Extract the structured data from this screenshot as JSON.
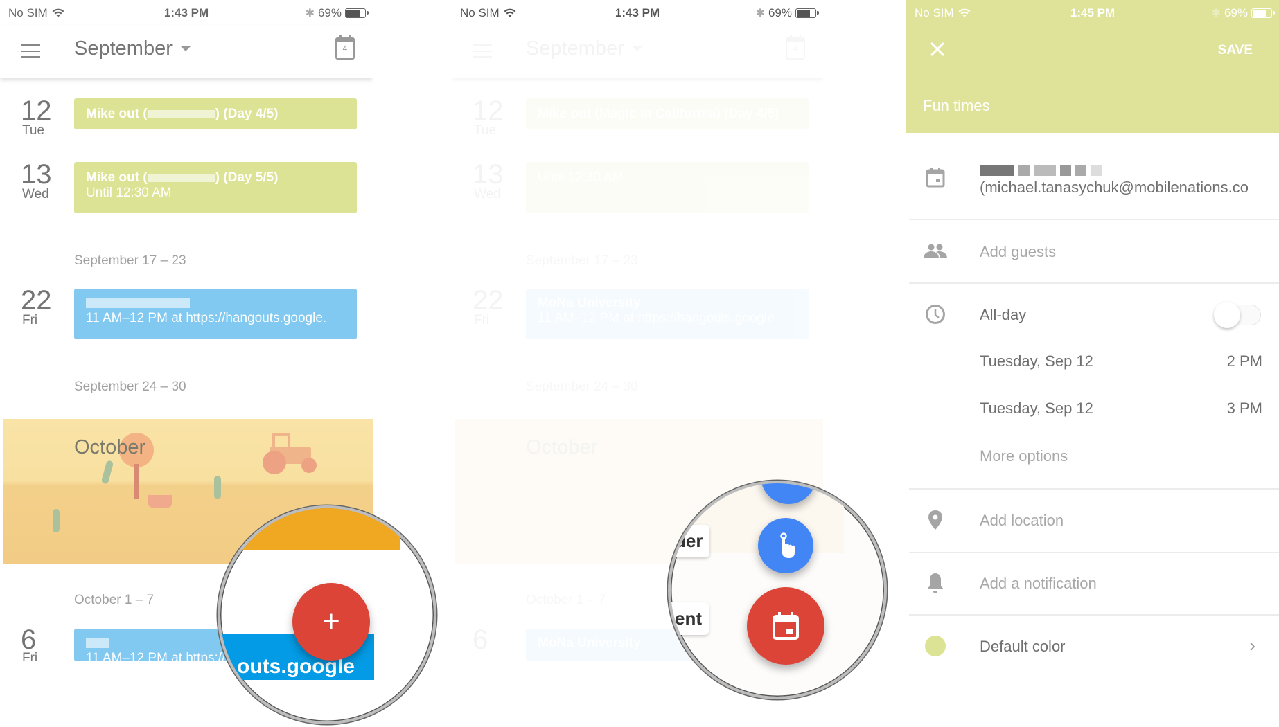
{
  "panels": {
    "agenda": {
      "status": {
        "carrier": "No SIM",
        "time": "1:43 PM",
        "battery": "69%",
        "battery_level": 0.69
      },
      "header": {
        "month": "September",
        "today_day": "4"
      },
      "days": [
        {
          "num": "12",
          "name": "Tue",
          "event_title": "Mike out (Magic in California) (Day 4/5)",
          "event_title_pre": "Mike out (",
          "event_title_post": ") (Day 4/5)",
          "event_sub": ""
        },
        {
          "num": "13",
          "name": "Wed",
          "event_title_pre": "Mike out (",
          "event_title_post": ") (Day 5/5)",
          "event_sub": "Until 12:30 AM"
        },
        {
          "num": "22",
          "name": "Fri",
          "event_title": "MoNa University",
          "event_sub": "11 AM–12 PM at https://hangouts.google."
        },
        {
          "num": "6",
          "name": "Fri",
          "event_title": "MoNa University",
          "event_sub": "11 AM–12 PM at https://hangouts.google."
        }
      ],
      "weeks": [
        "September 17 – 23",
        "September 24 – 30",
        "October 1 – 7"
      ],
      "banner": "October",
      "magnifier": {
        "fab_symbol": "+",
        "partial_text": "outs.google"
      }
    },
    "speed_dial": {
      "status": {
        "carrier": "No SIM",
        "time": "1:43 PM",
        "battery": "69%"
      },
      "magnifier": {
        "label_reminder": "der",
        "label_event": "ent"
      }
    },
    "edit": {
      "status": {
        "carrier": "No SIM",
        "time": "1:45 PM",
        "battery": "69%"
      },
      "save_label": "SAVE",
      "title": "Fun times",
      "calendar_account": "(michael.tanasychuk@mobilenations.co",
      "add_guests": "Add guests",
      "all_day_label": "All-day",
      "all_day_on": false,
      "start_date": "Tuesday, Sep 12",
      "start_time": "2 PM",
      "end_date": "Tuesday, Sep 12",
      "end_time": "3 PM",
      "more_options": "More options",
      "add_location": "Add location",
      "add_notification": "Add a notification",
      "color_label": "Default color",
      "color_hex": "#dde395"
    }
  },
  "colors": {
    "event_green": "#dde395",
    "event_blue": "#81c9f0",
    "fab_red": "#db4437",
    "fab_blue": "#4285f4",
    "header_green": "#dee399"
  }
}
